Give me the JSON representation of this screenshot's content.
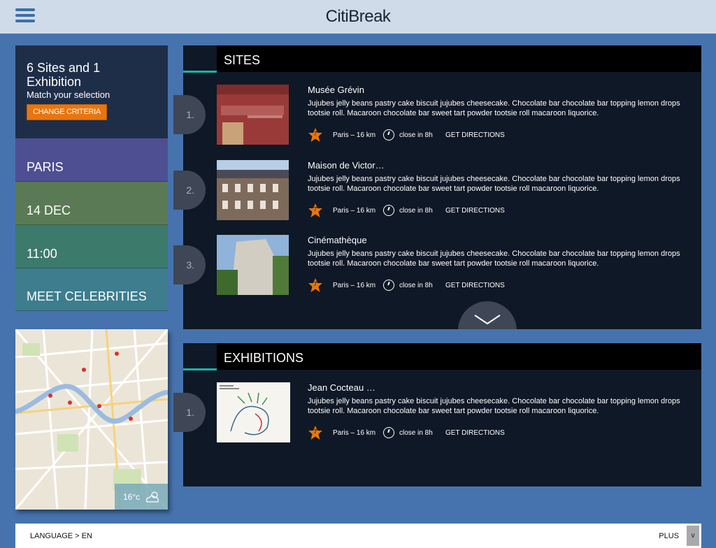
{
  "header": {
    "title": "CitiBreak"
  },
  "summary": {
    "heading": "6 Sites and 1 Exhibition",
    "subheading": "Match your selection",
    "change_label": "CHANGE CRITERIA"
  },
  "criteria": [
    {
      "label": "PARIS",
      "color": "#4e4f92"
    },
    {
      "label": "14 DEC",
      "color": "#5a7a55"
    },
    {
      "label": "11:00",
      "color": "#3c7a6c"
    },
    {
      "label": "MEET CELEBRITIES",
      "color": "#3d7d8e"
    }
  ],
  "map": {
    "temperature": "16°c",
    "weather_icon": "cloud-sun-icon"
  },
  "sites": {
    "title": "SITES",
    "items": [
      {
        "number": "1.",
        "name": "Musée Grévin",
        "description": "Jujubes jelly beans pastry cake biscuit jujubes cheesecake. Chocolate bar chocolate bar topping lemon drops tootsie roll. Macaroon chocolate bar sweet tart powder tootsie roll macaroon liquorice.",
        "rating": "7",
        "distance": "Paris – 16 km",
        "closing": "close in 8h",
        "directions": "GET DIRECTIONS"
      },
      {
        "number": "2.",
        "name": "Maison de Victor…",
        "description": "Jujubes jelly beans pastry cake biscuit jujubes cheesecake. Chocolate bar chocolate bar topping lemon drops tootsie roll. Macaroon chocolate bar sweet tart powder tootsie roll macaroon liquorice.",
        "rating": "7",
        "distance": "Paris – 16 km",
        "closing": "close in 8h",
        "directions": "GET DIRECTIONS"
      },
      {
        "number": "3.",
        "name": "Cinémathèque",
        "description": "Jujubes jelly beans pastry cake biscuit jujubes cheesecake. Chocolate bar chocolate bar topping lemon drops tootsie roll. Macaroon chocolate bar sweet tart powder tootsie roll macaroon liquorice.",
        "rating": "7",
        "distance": "Paris – 16 km",
        "closing": "close in 8h",
        "directions": "GET DIRECTIONS"
      }
    ]
  },
  "exhibitions": {
    "title": "EXHIBITIONS",
    "items": [
      {
        "number": "1.",
        "name": "Jean Cocteau …",
        "description": "Jujubes jelly beans pastry cake biscuit jujubes cheesecake. Chocolate bar chocolate bar topping lemon drops tootsie roll. Macaroon chocolate bar sweet tart powder tootsie roll macaroon liquorice.",
        "rating": "7",
        "distance": "Paris – 16 km",
        "closing": "close in 8h",
        "directions": "GET DIRECTIONS"
      }
    ]
  },
  "footer": {
    "language": "LANGUAGE > EN",
    "plus": "PLUS"
  },
  "colors": {
    "accent": "#e8760e",
    "teal": "#1ab3a3",
    "background": "#4673ad"
  }
}
